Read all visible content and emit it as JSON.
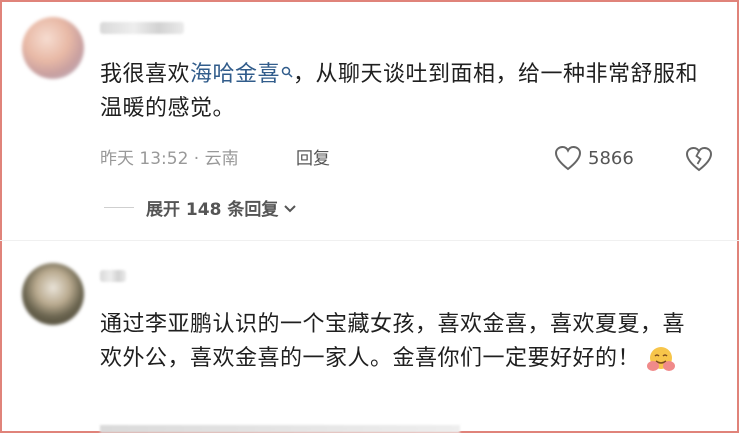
{
  "comment1": {
    "text_before": "我很喜欢",
    "link": "海哈金喜",
    "text_after": "，从聊天谈吐到面相，给一种非常舒服和温暖的感觉。",
    "meta": "昨天 13:52 · 云南",
    "reply_label": "回复",
    "like_count": "5866",
    "expand_label": "展开 148 条回复"
  },
  "comment2": {
    "text": "通过李亚鹏认识的一个宝藏女孩，喜欢金喜，喜欢夏夏，喜欢外公，喜欢金喜的一家人。金喜你们一定要好好的！"
  },
  "icons": {
    "like": "heart-icon",
    "dislike": "broken-heart-icon",
    "search": "search-icon",
    "expand": "chevron-down-icon",
    "emoji": "hugging-emoji"
  },
  "colors": {
    "link": "#315c8b",
    "frame": "#e0837a"
  }
}
